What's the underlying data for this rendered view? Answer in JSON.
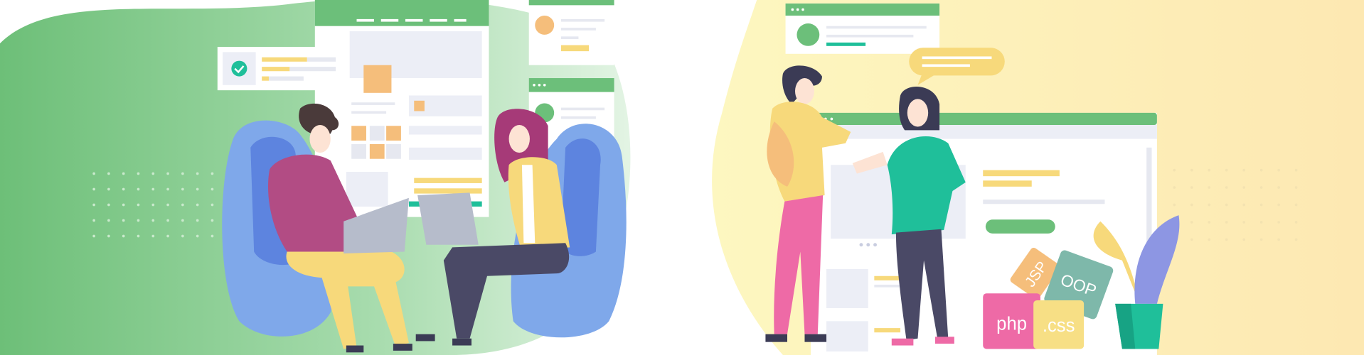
{
  "tags": {
    "jsp": "JSP",
    "oop": "OOP",
    "php": "php",
    "css": ".css"
  },
  "colors": {
    "green": "#6cbf7a",
    "yellow_bg": "#fdf1b0",
    "blue_chair": "#7fa8ea",
    "pink": "#ee6aa6",
    "teal": "#1fbf9a"
  }
}
